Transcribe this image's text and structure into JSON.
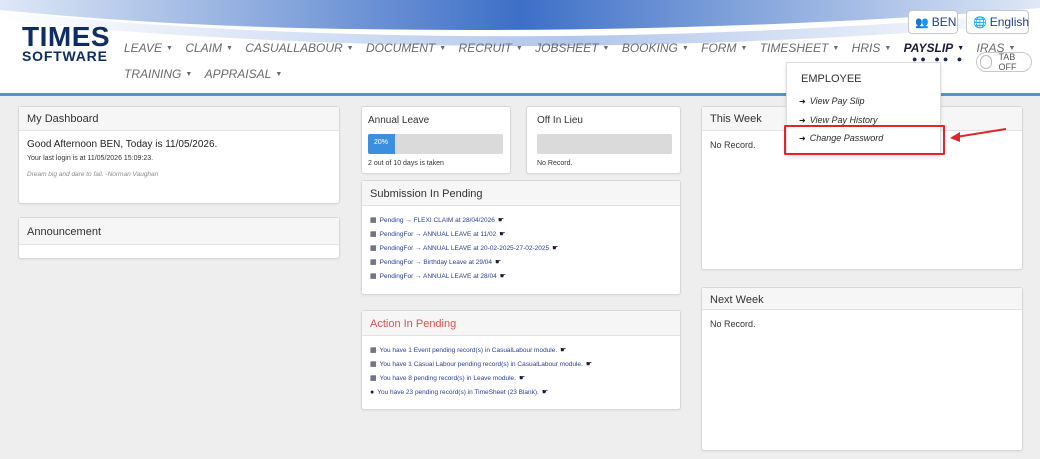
{
  "logo": {
    "line1": "TIMES",
    "line2": "SOFTWARE"
  },
  "nav": {
    "row1": [
      {
        "label": "LEAVE"
      },
      {
        "label": "CLAIM"
      },
      {
        "label": "CASUALLABOUR"
      },
      {
        "label": "DOCUMENT"
      },
      {
        "label": "RECRUIT"
      },
      {
        "label": "JOBSHEET"
      },
      {
        "label": "BOOKING"
      },
      {
        "label": "FORM"
      },
      {
        "label": "TIMESHEET"
      },
      {
        "label": "HRIS"
      },
      {
        "label": "PAYSLIP",
        "active": true
      },
      {
        "label": "IRAS"
      }
    ],
    "row2": [
      {
        "label": "TRAINING"
      },
      {
        "label": "APPRAISAL"
      }
    ]
  },
  "header": {
    "user_label": "BEN",
    "lang_label": "English",
    "toggle_label": "TAB OFF"
  },
  "dashboard": {
    "title": "My Dashboard",
    "greeting": "Good Afternoon BEN, Today is 11/05/2026.",
    "last_login": "Your last login is at 11/05/2026 15:09:23.",
    "quote": "Dream big and dare to fail. -Norman Vaughan"
  },
  "announcement": {
    "title": "Announcement"
  },
  "annual_leave": {
    "title": "Annual Leave",
    "percent": 20,
    "percent_label": "20%",
    "text": "2 out of 10 days is taken"
  },
  "off_in_lieu": {
    "title": "Off In Lieu",
    "text": "No Record."
  },
  "submission": {
    "title": "Submission In Pending",
    "items": [
      "Pending → FLEXI CLAIM at 28/04/2026",
      "PendingFor → ANNUAL LEAVE at 11/02",
      "PendingFor → ANNUAL LEAVE at 20-02-2025-27-02-2025",
      "PendingFor → Birthday Leave at 29/04",
      "PendingFor → ANNUAL LEAVE at 28/04"
    ]
  },
  "action": {
    "title": "Action In Pending",
    "items": [
      "You have 1 Event pending record(s) in CasualLabour module.",
      "You have 1 Casual Labour pending record(s) in CasualLabour module.",
      "You have 8 pending record(s) in Leave module.",
      "You have 23 pending record(s) in TimeSheet (23 Blank)."
    ]
  },
  "this_week": {
    "title": "This Week",
    "text": "No Record."
  },
  "next_week": {
    "title": "Next Week",
    "text": "No Record."
  },
  "dropdown": {
    "heading": "EMPLOYEE",
    "items": [
      "View Pay Slip",
      "View Pay History",
      "Change Password"
    ]
  },
  "colors": {
    "accent": "#3c8fde",
    "brand": "#0d2d63",
    "highlight": "#e0262c"
  }
}
